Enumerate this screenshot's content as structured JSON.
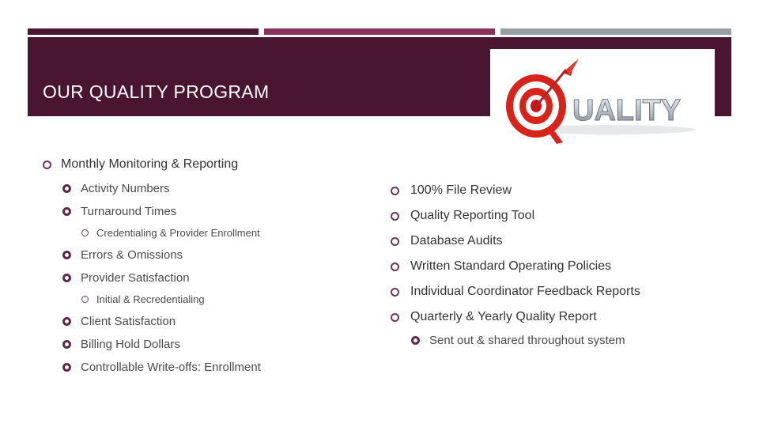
{
  "slide": {
    "title": "OUR QUALITY PROGRAM",
    "colors": {
      "accent_dark": "#4a1530",
      "accent_mid": "#8c2e5e",
      "accent_gray": "#979ea4"
    }
  },
  "logo": {
    "icon": "quality-target-logo-icon",
    "text": "UALITY",
    "letter": "Q"
  },
  "left_column": {
    "heading": "Monthly Monitoring & Reporting",
    "items": [
      {
        "label": "Activity Numbers"
      },
      {
        "label": "Turnaround Times",
        "sub": "Credentialing & Provider Enrollment"
      },
      {
        "label": "Errors & Omissions"
      },
      {
        "label": "Provider Satisfaction",
        "sub": "Initial & Recredentialing"
      },
      {
        "label": "Client Satisfaction"
      },
      {
        "label": "Billing Hold Dollars"
      },
      {
        "label": "Controllable Write-offs:  Enrollment"
      }
    ]
  },
  "right_column": {
    "items": [
      {
        "label": "100% File Review"
      },
      {
        "label": "Quality Reporting Tool"
      },
      {
        "label": "Database Audits"
      },
      {
        "label": "Written Standard Operating Policies"
      },
      {
        "label": "Individual Coordinator Feedback Reports"
      },
      {
        "label": "Quarterly & Yearly Quality Report",
        "sub": "Sent out & shared throughout system"
      }
    ]
  }
}
